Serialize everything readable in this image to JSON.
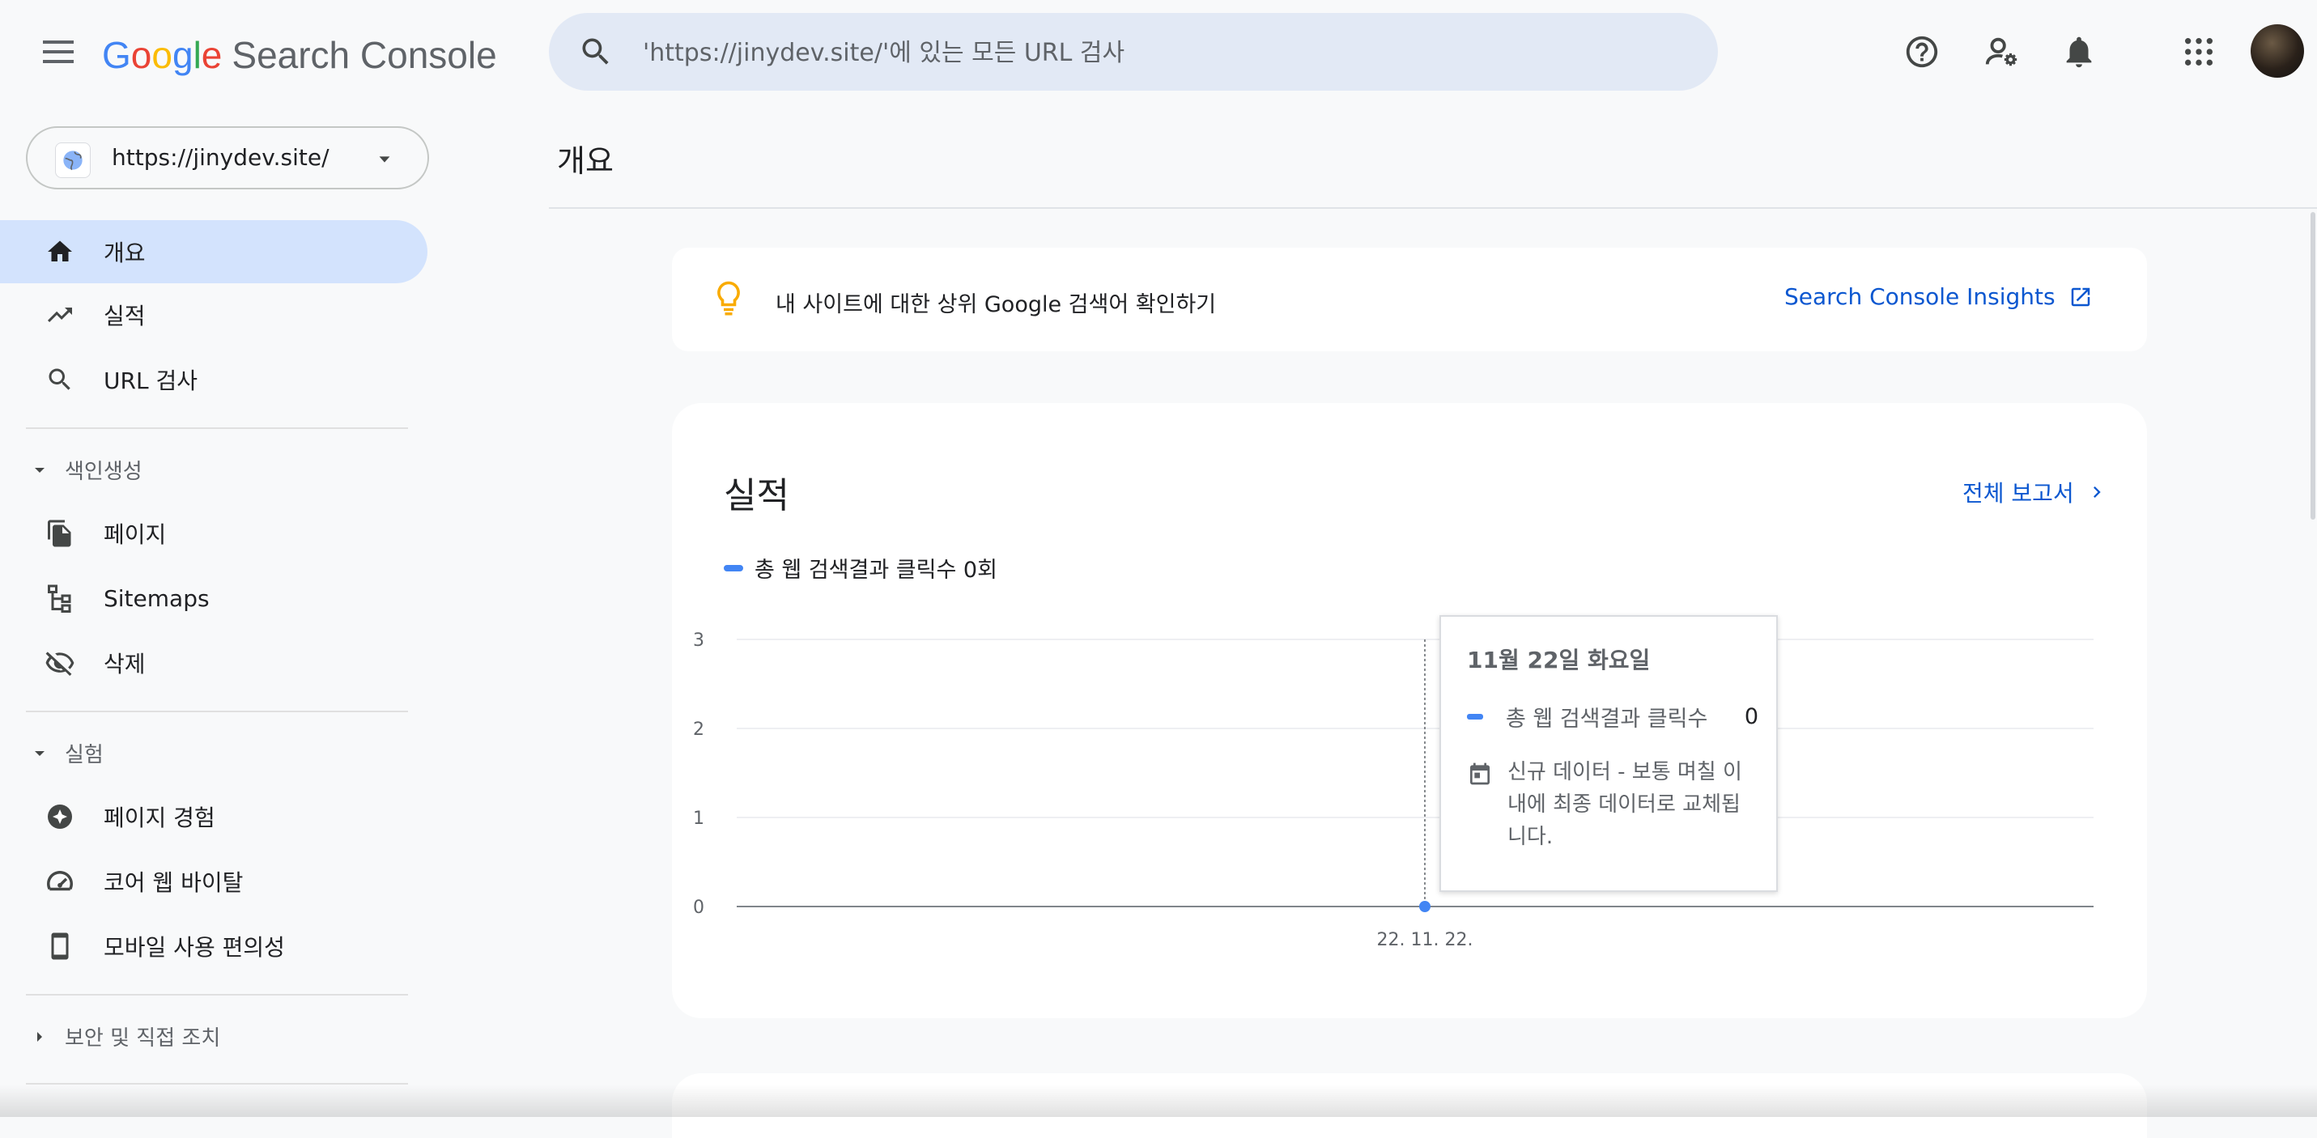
{
  "topbar": {
    "logo_google": [
      "G",
      "o",
      "o",
      "g",
      "l",
      "e"
    ],
    "logo_colors": [
      "#4285F4",
      "#EA4335",
      "#FBBC05",
      "#4285F4",
      "#34A853",
      "#EA4335"
    ],
    "product_name": "Search Console",
    "search_placeholder": "'https://jinydev.site/'에 있는 모든 URL 검사",
    "icons": [
      "help-icon",
      "manage-users-icon",
      "notifications-icon",
      "apps-grid-icon",
      "account-avatar"
    ]
  },
  "sidebar": {
    "property_url": "https://jinydev.site/",
    "items": [
      {
        "label": "개요",
        "icon": "home-icon",
        "active": true
      },
      {
        "label": "실적",
        "icon": "trending-up-icon"
      },
      {
        "label": "URL 검사",
        "icon": "search-icon"
      }
    ],
    "sections": [
      {
        "label": "색인생성",
        "expanded": true,
        "items": [
          {
            "label": "페이지",
            "icon": "pages-icon"
          },
          {
            "label": "Sitemaps",
            "icon": "sitemap-icon"
          },
          {
            "label": "삭제",
            "icon": "visibility-off-icon"
          }
        ]
      },
      {
        "label": "실험",
        "expanded": true,
        "items": [
          {
            "label": "페이지 경험",
            "icon": "star-badge-icon"
          },
          {
            "label": "코어 웹 바이탈",
            "icon": "speed-gauge-icon"
          },
          {
            "label": "모바일 사용 편의성",
            "icon": "smartphone-icon"
          }
        ]
      },
      {
        "label": "보안 및 직접 조치",
        "expanded": false,
        "items": []
      }
    ]
  },
  "main": {
    "page_title": "개요",
    "insight": {
      "text": "내 사이트에 대한 상위 Google 검색어 확인하기",
      "link": "Search Console Insights"
    },
    "performance": {
      "title": "실적",
      "full_report": "전체 보고서",
      "legend": "총 웹 검색결과 클릭수 0회"
    },
    "tooltip": {
      "date": "11월 22일 화요일",
      "series_label": "총 웹 검색결과 클릭수",
      "value": "0",
      "note": "신규 데이터 - 보통 며칠 이내에 최종 데이터로 교체됩니다."
    }
  },
  "chart_data": {
    "type": "line",
    "title": "",
    "xlabel": "",
    "ylabel": "",
    "x": [
      "22. 11. 22."
    ],
    "series": [
      {
        "name": "총 웹 검색결과 클릭수",
        "values": [
          0
        ]
      }
    ],
    "yticks": [
      0,
      1,
      2,
      3
    ],
    "ylim": [
      0,
      3
    ],
    "grid": true,
    "color": "#4285f4"
  }
}
